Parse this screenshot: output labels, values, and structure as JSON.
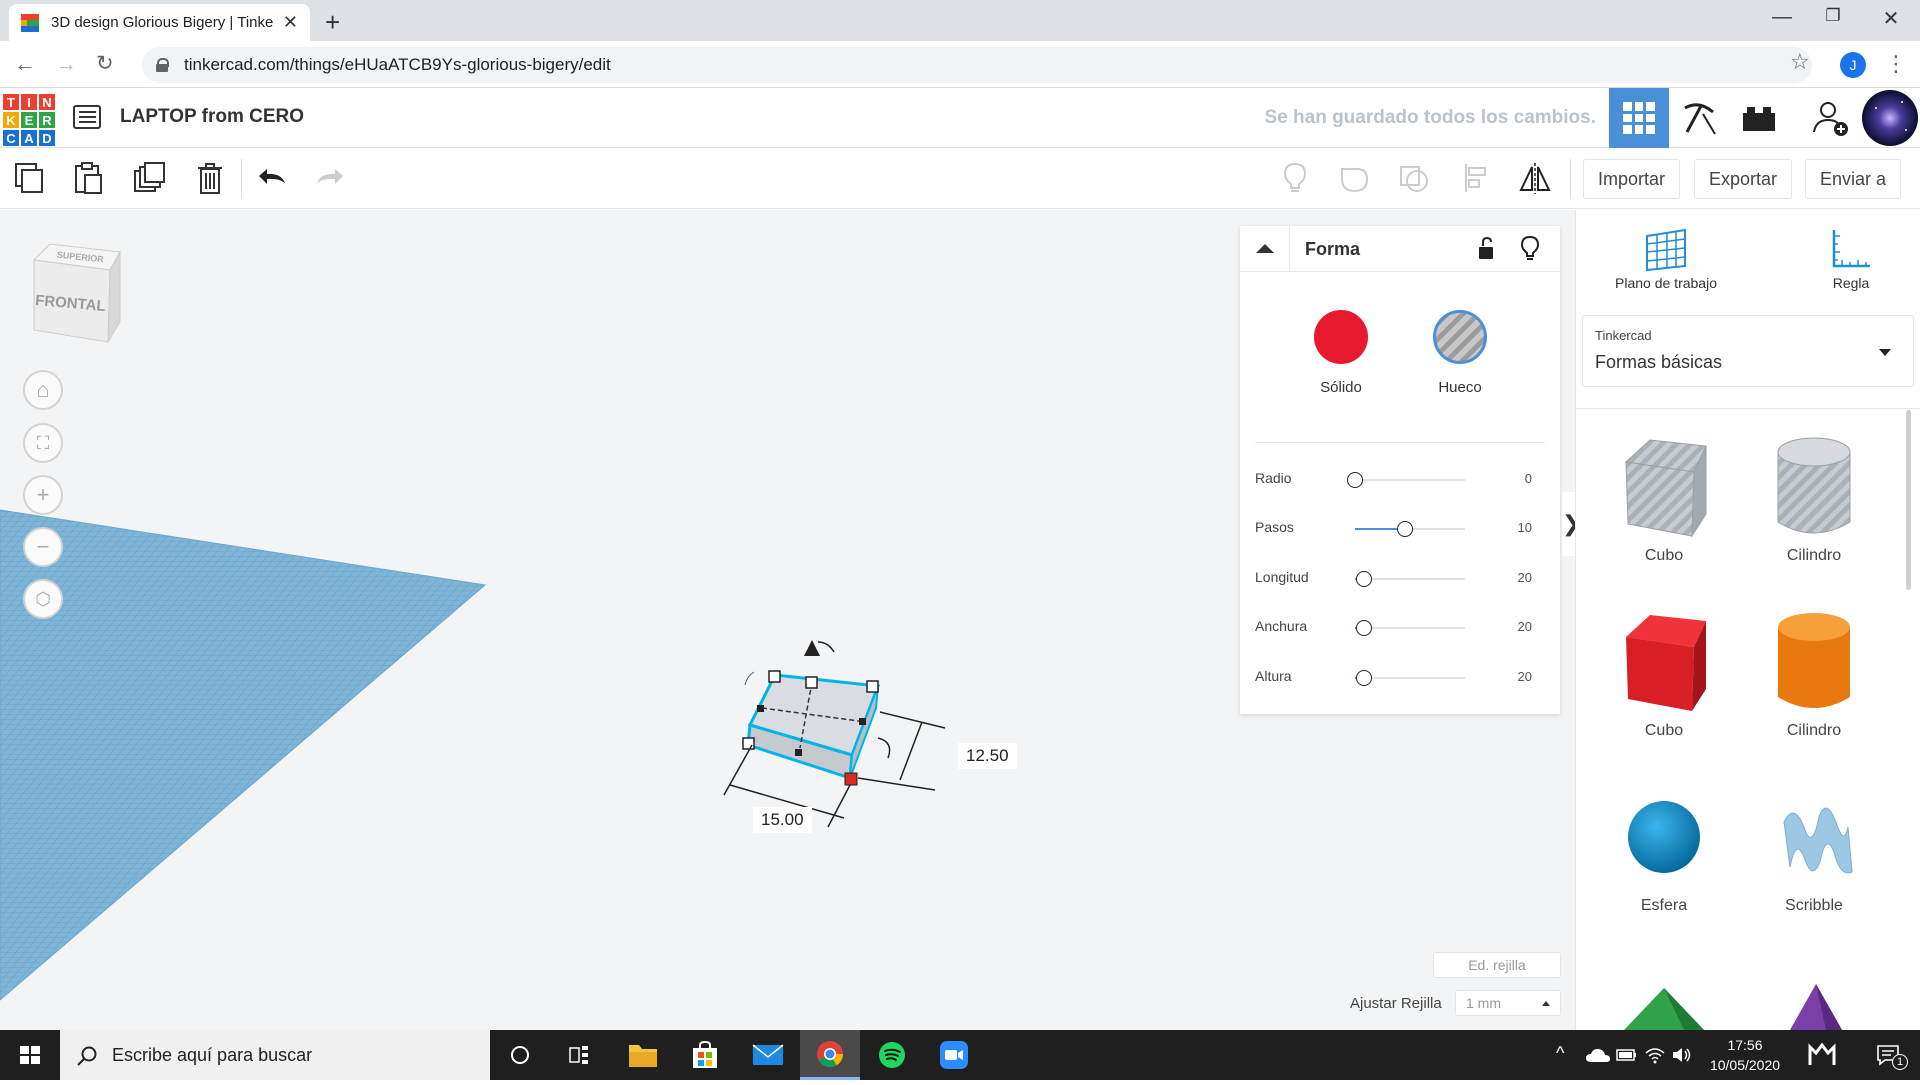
{
  "browser": {
    "tab_title": "3D design Glorious Bigery | Tinke",
    "url": "tinkercad.com/things/eHUaATCB9Ys-glorious-bigery/edit",
    "profile_initial": "J"
  },
  "header": {
    "logo_letters": [
      "T",
      "I",
      "N",
      "K",
      "E",
      "R",
      "C",
      "A",
      "D"
    ],
    "logo_colors": [
      "#e8412f",
      "#e8412f",
      "#e8412f",
      "#f6a800",
      "#2fa24a",
      "#2fa24a",
      "#1a6fd5",
      "#1a6fd5",
      "#1a6fd5"
    ],
    "design_title": "LAPTOP from CERO",
    "save_status": "Se han guardado todos los cambios."
  },
  "toolbar": {
    "import_label": "Importar",
    "export_label": "Exportar",
    "send_label": "Enviar a"
  },
  "viewcube": {
    "top_label": "SUPERIOR",
    "front_label": "FRONTAL"
  },
  "shape_panel": {
    "title": "Forma",
    "solid_label": "Sólido",
    "hole_label": "Hueco",
    "solid_color": "#e8192c",
    "properties": [
      {
        "label": "Radio",
        "value": "0",
        "level": 0.0
      },
      {
        "label": "Pasos",
        "value": "10",
        "level": 0.45
      },
      {
        "label": "Longitud",
        "value": "20",
        "level": 0.08
      },
      {
        "label": "Anchura",
        "value": "20",
        "level": 0.08
      },
      {
        "label": "Altura",
        "value": "20",
        "level": 0.08
      }
    ]
  },
  "dimensions": {
    "width": "15.00",
    "depth": "12.50"
  },
  "library": {
    "workplane_label": "Plano de trabajo",
    "ruler_label": "Regla",
    "source_label": "Tinkercad",
    "category_label": "Formas básicas",
    "shapes": [
      {
        "label": "Cubo",
        "icon": "box-hole-icon"
      },
      {
        "label": "Cilindro",
        "icon": "cylinder-hole-icon"
      },
      {
        "label": "Cubo",
        "icon": "box-red-icon"
      },
      {
        "label": "Cilindro",
        "icon": "cylinder-orange-icon"
      },
      {
        "label": "Esfera",
        "icon": "sphere-blue-icon"
      },
      {
        "label": "Scribble",
        "icon": "scribble-icon"
      }
    ]
  },
  "bottom": {
    "edit_grid_label": "Ed. rejilla",
    "snap_grid_label": "Ajustar Rejilla",
    "snap_grid_value": "1 mm"
  },
  "taskbar": {
    "search_placeholder": "Escribe aquí para buscar",
    "time": "17:56",
    "date": "10/05/2020",
    "notification_count": "1"
  }
}
